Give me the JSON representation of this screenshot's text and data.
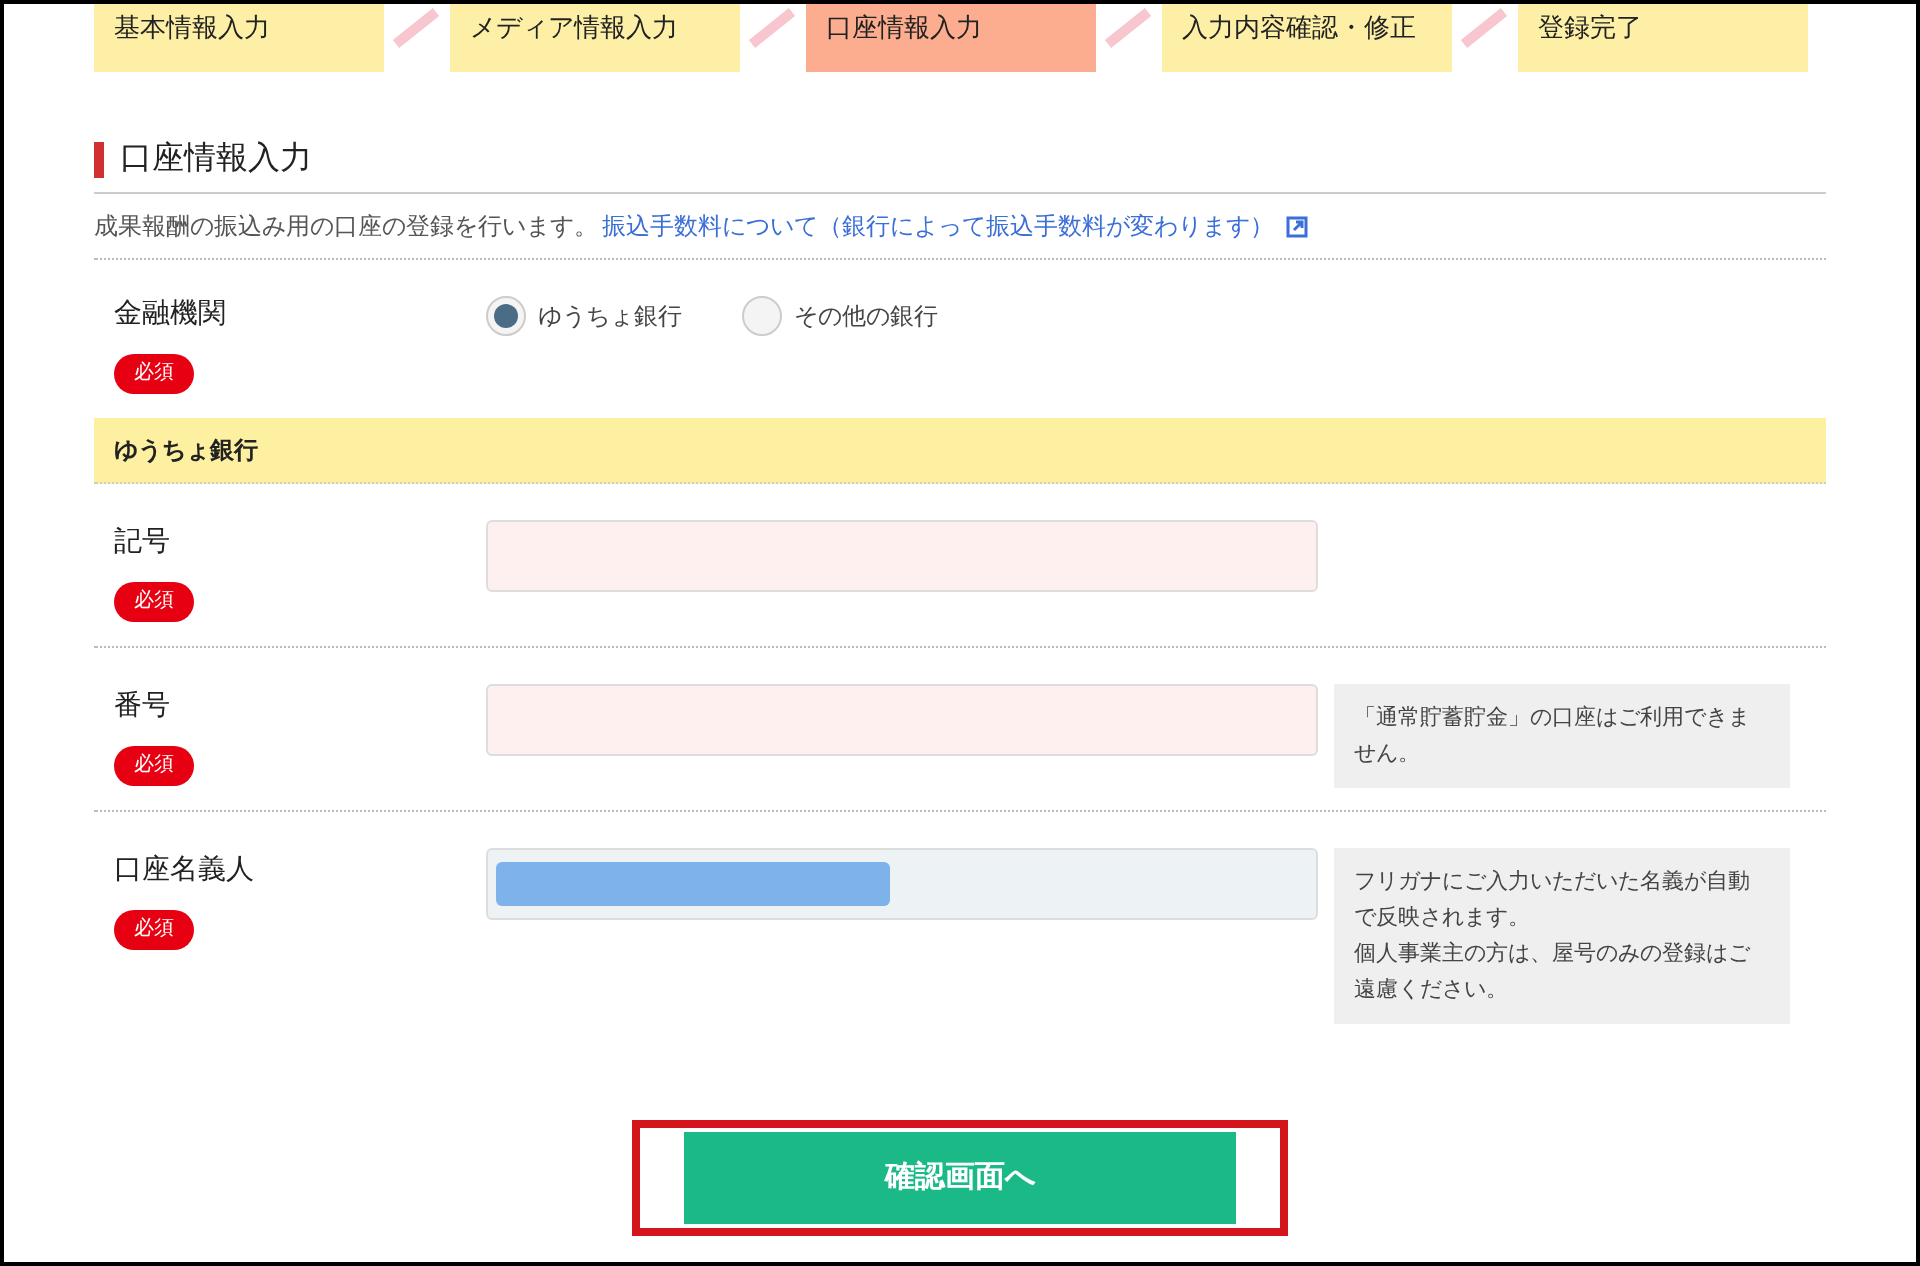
{
  "steps": [
    {
      "label": "基本情報入力",
      "selected": false
    },
    {
      "label": "メディア情報入力",
      "selected": false
    },
    {
      "label": "口座情報入力",
      "selected": true
    },
    {
      "label": "入力内容確認・修正",
      "selected": false
    },
    {
      "label": "登録完了",
      "selected": false
    }
  ],
  "section": {
    "title": "口座情報入力",
    "description": "成果報酬の振込み用の口座の登録を行います。",
    "link": "振込手数料について（銀行によって振込手数料が変わります）"
  },
  "bank": {
    "label": "金融機関",
    "required": "必須",
    "options": [
      {
        "label": "ゆうちょ銀行",
        "selected": true
      },
      {
        "label": "その他の銀行",
        "selected": false
      }
    ]
  },
  "band": "ゆうちょ銀行",
  "fields": [
    {
      "label": "記号",
      "required": "必須",
      "kind": "text"
    },
    {
      "label": "番号",
      "required": "必須",
      "kind": "text",
      "hint": [
        "「通常貯蓄貯金」の口座はご利用できません。"
      ]
    },
    {
      "label": "口座名義人",
      "required": "必須",
      "kind": "masked",
      "hint": [
        "フリガナにご入力いただいた名義が自動で反映されます。",
        "個人事業主の方は、屋号のみの登録はご遠慮ください。"
      ]
    }
  ],
  "submit": {
    "label": "確認画面へ",
    "highlighted": true
  }
}
